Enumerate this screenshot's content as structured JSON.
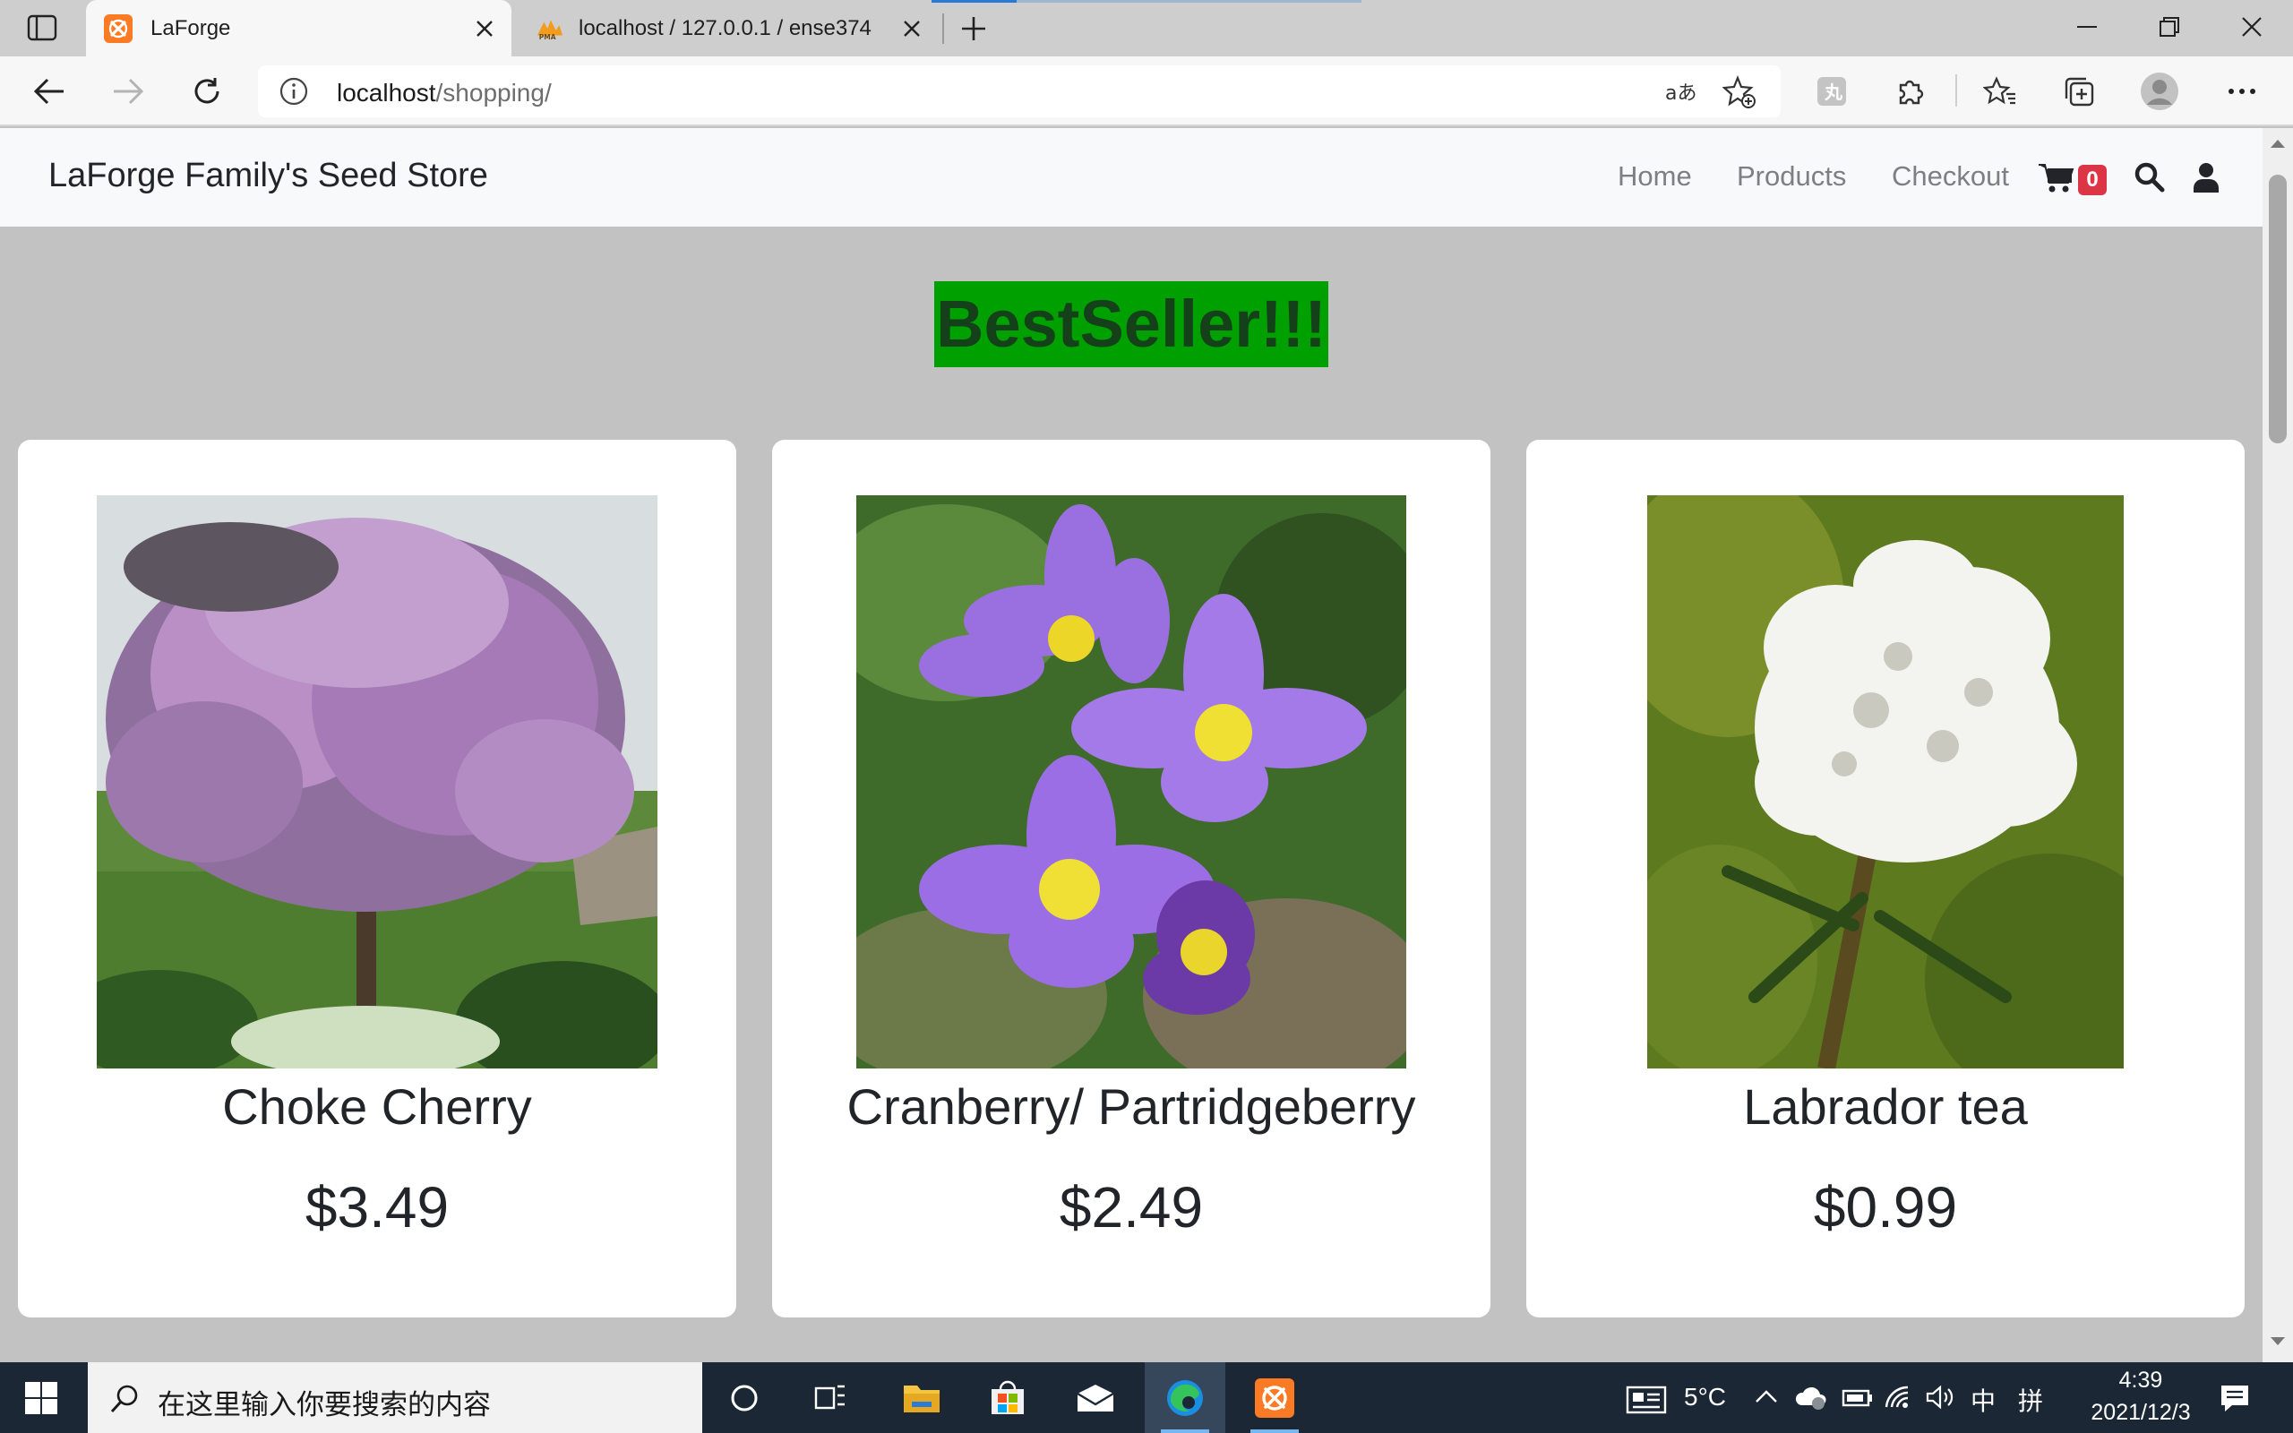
{
  "browser": {
    "tabs": [
      {
        "title": "LaForge",
        "active": true
      },
      {
        "title": "localhost / 127.0.0.1 / ense374 |",
        "active": false
      }
    ],
    "address": {
      "host": "localhost",
      "path": "/shopping/"
    }
  },
  "store": {
    "brand": "LaForge Family's Seed Store",
    "nav": {
      "home": "Home",
      "products": "Products",
      "checkout": "Checkout"
    },
    "cart_count": "0",
    "banner": "BestSeller!!!",
    "products": [
      {
        "name": "Choke Cherry",
        "price": "$3.49",
        "image": "lilac-tree-photo"
      },
      {
        "name": "Cranberry/ Partridgeberry",
        "price": "$2.49",
        "image": "purple-pasqueflower-photo"
      },
      {
        "name": "Labrador tea",
        "price": "$0.99",
        "image": "white-flower-cluster-photo"
      }
    ]
  },
  "taskbar": {
    "search_placeholder": "在这里输入你要搜索的内容",
    "weather": "5°C",
    "ime_lang": "中",
    "ime_mode": "拼",
    "time": "4:39",
    "date": "2021/12/3"
  },
  "colors": {
    "banner_bg": "#00a000",
    "badge": "#dc3545",
    "page_bg": "#c2c2c2"
  }
}
